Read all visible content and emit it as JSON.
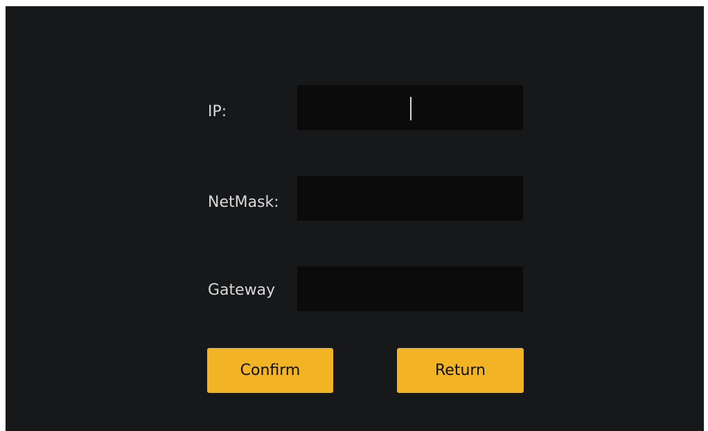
{
  "form": {
    "ip_label": "IP:",
    "ip_value": "",
    "netmask_label": "NetMask:",
    "netmask_value": "",
    "gateway_label": "Gateway",
    "gateway_value": ""
  },
  "actions": {
    "confirm_label": "Confirm",
    "return_label": "Return"
  },
  "colors": {
    "background": "#17181a",
    "field_background": "#0b0b0b",
    "text": "#d9d9d9",
    "button_accent": "#f2b324"
  }
}
